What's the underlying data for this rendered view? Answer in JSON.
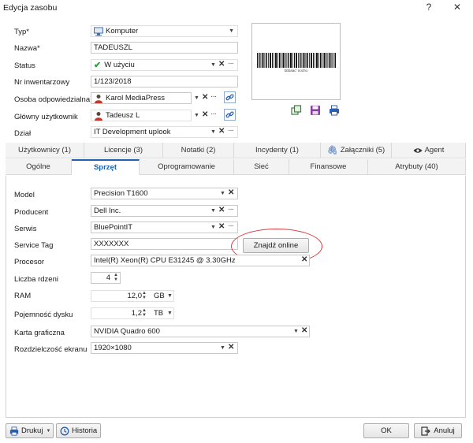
{
  "window": {
    "title": "Edycja zasobu",
    "help_label": "?",
    "close_label": "✕"
  },
  "header": {
    "typ_label": "Typ*",
    "typ_value": "Komputer",
    "nazwa_label": "Nazwa*",
    "nazwa_value": "TADEUSZL",
    "status_label": "Status",
    "status_value": "W użyciu",
    "nr_label": "Nr inwentarzowy",
    "nr_value": "1/123/2018",
    "osoba_label": "Osoba odpowiedzialna",
    "osoba_value": "Karol MediaPress",
    "glowny_label": "Główny użytkownik",
    "glowny_value": "Tadeusz L",
    "dzial_label": "Dział",
    "dzial_value": "IT Development uplook"
  },
  "barcode": {
    "caption": "bbbaac' nocho"
  },
  "tabs_row1": [
    {
      "label": "Użytkownicy (1)"
    },
    {
      "label": "Licencje (3)"
    },
    {
      "label": "Notatki (2)"
    },
    {
      "label": "Incydenty (1)"
    },
    {
      "label": "Załączniki (5)"
    },
    {
      "label": "Agent"
    }
  ],
  "tabs_row2": [
    {
      "label": "Ogólne"
    },
    {
      "label": "Sprzęt"
    },
    {
      "label": "Oprogramowanie"
    },
    {
      "label": "Sieć"
    },
    {
      "label": "Finansowe"
    },
    {
      "label": "Atrybuty (40)"
    }
  ],
  "active_tab": "Sprzęt",
  "hardware": {
    "model_label": "Model",
    "model_value": "Precision T1600",
    "producent_label": "Producent",
    "producent_value": "Dell Inc.",
    "serwis_label": "Serwis",
    "serwis_value": "BluePointIT",
    "service_tag_label": "Service Tag",
    "service_tag_value": "XXXXXXX",
    "find_online_label": "Znajdź online",
    "procesor_label": "Procesor",
    "procesor_value": "Intel(R) Xeon(R) CPU E31245 @ 3.30GHz",
    "rdzenie_label": "Liczba rdzeni",
    "rdzenie_value": "4",
    "ram_label": "RAM",
    "ram_value": "12,0",
    "ram_unit": "GB",
    "dysk_label": "Pojemność dysku",
    "dysk_value": "1,2",
    "dysk_unit": "TB",
    "karta_label": "Karta graficzna",
    "karta_value": "NVIDIA Quadro 600",
    "rozdz_label": "Rozdzielczość ekranu",
    "rozdz_value": "1920×1080"
  },
  "footer": {
    "print_label": "Drukuj",
    "history_label": "Historia",
    "ok_label": "OK",
    "cancel_label": "Anuluj"
  },
  "colors": {
    "accent": "#1f5fb4",
    "highlight_circle": "#d9393c",
    "status_check": "#2e9e3f"
  }
}
